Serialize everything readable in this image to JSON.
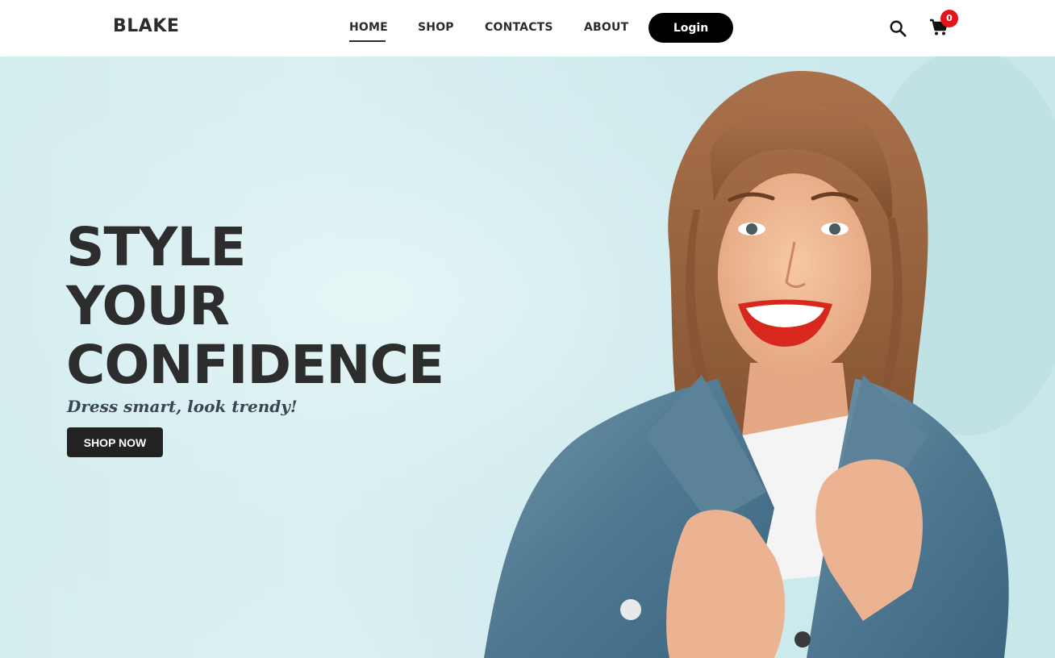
{
  "header": {
    "brand": "BLAKE",
    "nav": {
      "home": "HOME",
      "shop": "SHOP",
      "contacts": "CONTACTS",
      "about": "ABOUT"
    },
    "login_label": "Login",
    "cart_count": "0",
    "icons": [
      "search-icon",
      "cart-icon"
    ]
  },
  "hero": {
    "title_lines": [
      "STYLE",
      "YOUR",
      "CONFIDENCE"
    ],
    "subtitle": "Dress smart, look trendy!",
    "cta_label": "SHOP NOW"
  },
  "colors": {
    "text_dark": "#2c2c2c",
    "hero_bg": "#d5eef0",
    "badge_red": "#e3151b",
    "button_dark": "#222222"
  }
}
